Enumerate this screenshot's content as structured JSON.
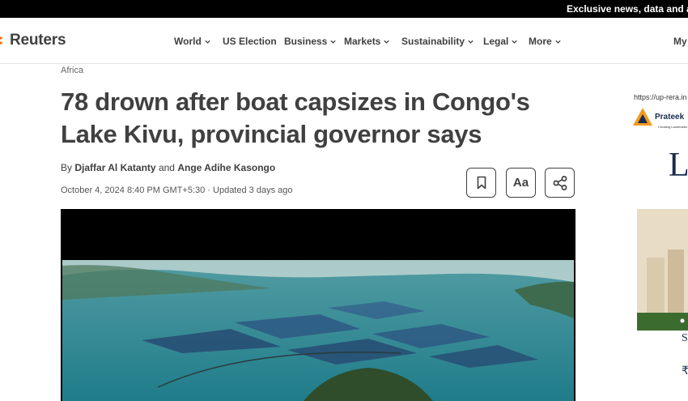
{
  "topbar": {
    "promo": "Exclusive news, data and analytics"
  },
  "header": {
    "brand": "Reuters",
    "brand_color": "#fa6400",
    "nav": [
      {
        "label": "World",
        "dropdown": true
      },
      {
        "label": "US Election",
        "dropdown": false
      },
      {
        "label": "Business",
        "dropdown": true
      },
      {
        "label": "Markets",
        "dropdown": true
      },
      {
        "label": "Sustainability",
        "dropdown": true
      },
      {
        "label": "Legal",
        "dropdown": true
      },
      {
        "label": "More",
        "dropdown": true
      }
    ],
    "account_label": "My"
  },
  "article": {
    "section": "Africa",
    "headline": "78 drown after boat capsizes in Congo's Lake Kivu, provincial governor says",
    "by": "By",
    "authors": [
      "Djaffar Al Katanty",
      "Ange Adihe Kasongo"
    ],
    "and": "and",
    "date": "October 4, 2024 8:40 PM GMT+5:30 · Updated 3 days ago",
    "tools": [
      {
        "label": "",
        "icon": "bookmark-icon"
      },
      {
        "label": "Aa",
        "icon": "text-size"
      },
      {
        "label": "",
        "icon": "share-icon"
      }
    ],
    "media": {
      "kind": "video",
      "description_icon": "lake-scene"
    }
  },
  "ad": {
    "url": "https://up-rera.in",
    "brand": "Prateek",
    "tagline": "Creating Landmarks",
    "big_letter": "L",
    "glyphs": [
      "S",
      "₹"
    ]
  }
}
